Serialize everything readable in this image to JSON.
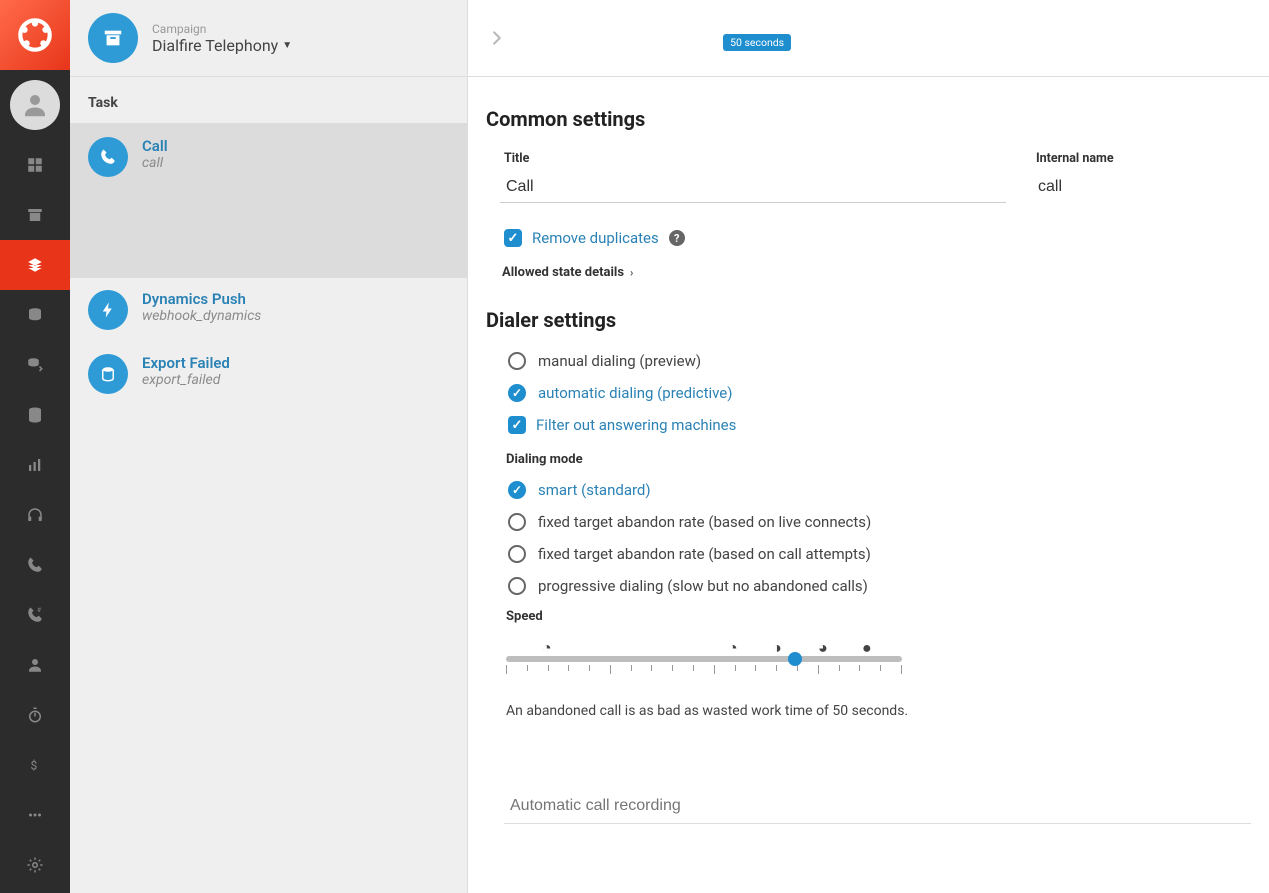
{
  "leftRail": {
    "icons": [
      "dashboard",
      "archive",
      "layers",
      "coins",
      "coins-out",
      "database",
      "bar-chart",
      "headphones",
      "phone",
      "dial-pad",
      "user",
      "stopwatch",
      "dollar",
      "ellipsis",
      "gear"
    ],
    "activeIndex": 2
  },
  "campaign": {
    "label": "Campaign",
    "name": "Dialfire Telephony"
  },
  "taskHeading": "Task",
  "tasks": [
    {
      "title": "Call",
      "sub": "call",
      "iconColor": "#2e9bd6",
      "selected": true,
      "icon": "phone"
    },
    {
      "title": "Dynamics Push",
      "sub": "webhook_dynamics",
      "iconColor": "#2e9bd6",
      "selected": false,
      "icon": "bolt"
    },
    {
      "title": "Export Failed",
      "sub": "export_failed",
      "iconColor": "#2e9bd6",
      "selected": false,
      "icon": "db"
    }
  ],
  "common": {
    "heading": "Common settings",
    "titleLabel": "Title",
    "titleValue": "Call",
    "internalLabel": "Internal name",
    "internalValue": "call",
    "removeDup": "Remove duplicates",
    "allowedState": "Allowed state details"
  },
  "dialer": {
    "heading": "Dialer settings",
    "manual": "manual dialing (preview)",
    "automatic": "automatic dialing (predictive)",
    "filterAM": "Filter out answering machines",
    "modeLabel": "Dialing mode",
    "modes": {
      "smart": "smart (standard)",
      "fixedLive": "fixed target abandon rate (based on live connects)",
      "fixedAttempt": "fixed target abandon rate (based on call attempts)",
      "progressive": "progressive dialing (slow but no abandoned calls)"
    },
    "speedLabel": "Speed",
    "sliderTooltip": "50 seconds",
    "sliderNote": "An abandoned call is as bad as wasted work time of 50 seconds.",
    "sliderPercent": 73
  },
  "recording": {
    "placeholder": "Automatic call recording",
    "value": ""
  }
}
